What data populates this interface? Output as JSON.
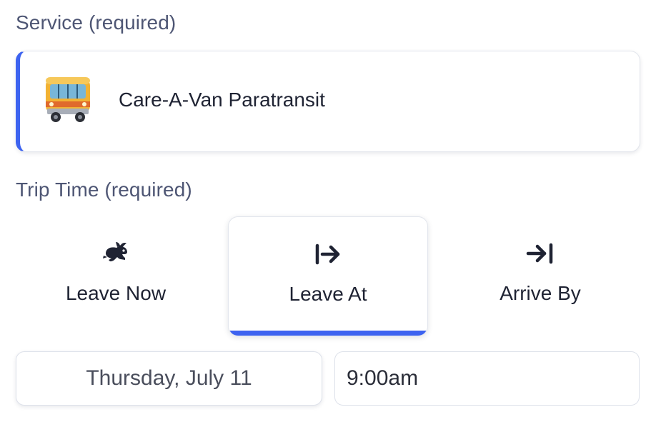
{
  "service": {
    "label": "Service (required)",
    "selected": {
      "name": "Care-A-Van Paratransit",
      "icon": "bus-icon"
    }
  },
  "trip_time": {
    "label": "Trip Time (required)",
    "options": [
      {
        "label": "Leave Now",
        "icon": "rabbit-icon",
        "selected": false
      },
      {
        "label": "Leave At",
        "icon": "arrow-right-from-bar-icon",
        "selected": true
      },
      {
        "label": "Arrive By",
        "icon": "arrow-right-to-bar-icon",
        "selected": false
      }
    ],
    "date": "Thursday, July 11",
    "time": "9:00am"
  },
  "colors": {
    "accent": "#3d63f0",
    "label": "#4e5674",
    "text": "#1f2333"
  }
}
